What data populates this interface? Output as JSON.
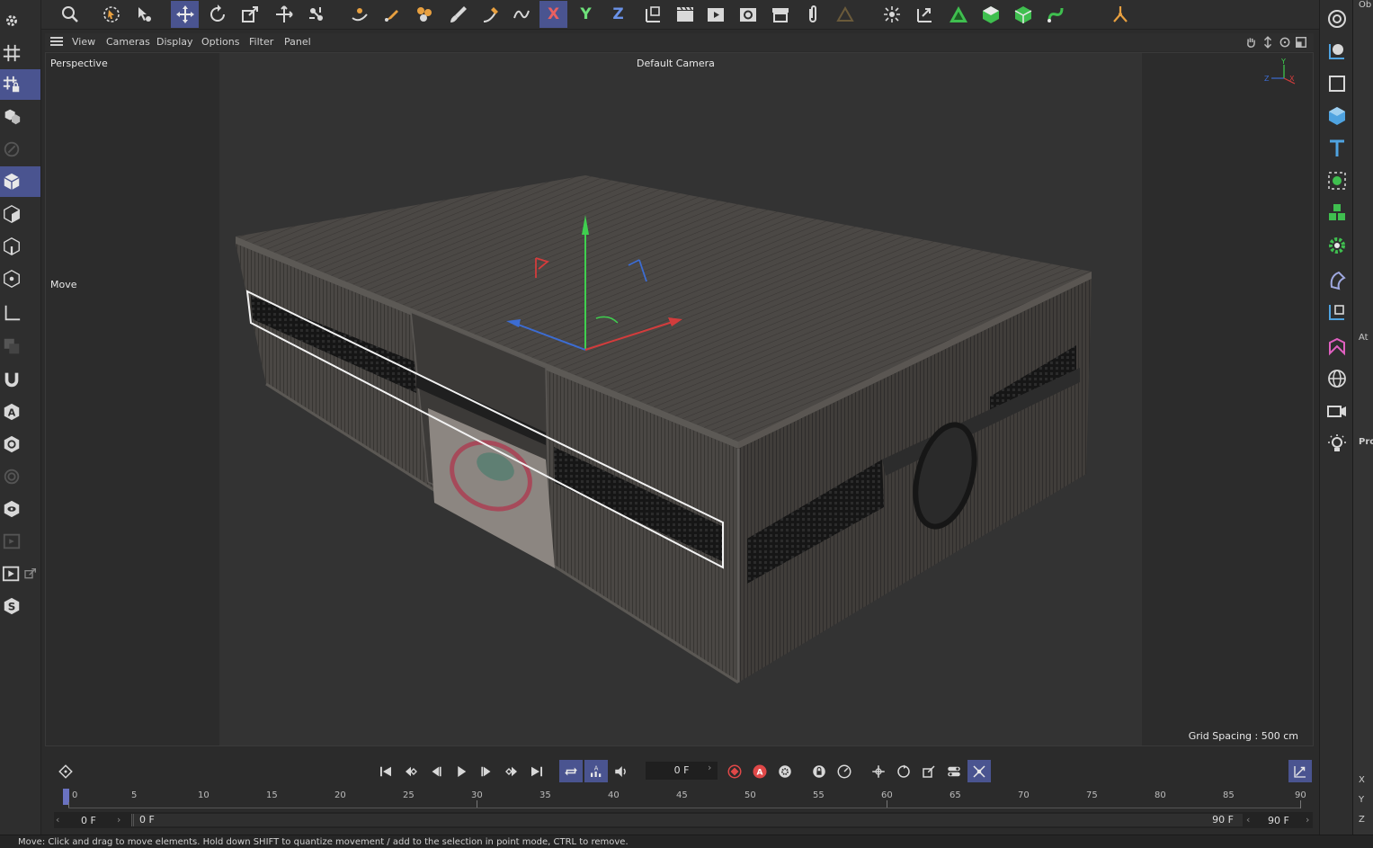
{
  "viewport": {
    "menu": [
      "View",
      "Cameras",
      "Display",
      "Options",
      "Filter",
      "Panel"
    ],
    "view_name": "Perspective",
    "camera": "Default Camera",
    "tool_label": "Move",
    "grid_spacing": "Grid Spacing : 500 cm",
    "axis_labels": {
      "x": "X",
      "y": "Y",
      "z": "Z"
    }
  },
  "toolbar": {
    "axis_x": "X",
    "axis_y": "Y",
    "axis_z": "Z",
    "active_tool": "move-tool"
  },
  "timeline": {
    "current_frame": "0 F",
    "ruler": [
      "0",
      "5",
      "10",
      "15",
      "20",
      "25",
      "30",
      "35",
      "40",
      "45",
      "50",
      "55",
      "60",
      "65",
      "70",
      "75",
      "80",
      "85",
      "90"
    ],
    "range_start": "0 F",
    "range_current": "0 F",
    "range_end": "90 F",
    "range_max": "90 F"
  },
  "side_panel": {
    "labels": [
      "Ob",
      "At",
      "Pro"
    ],
    "coords": [
      "X",
      "Y",
      "Z"
    ]
  },
  "status": "Move: Click and drag to move elements. Hold down SHIFT to quantize movement / add to the selection in point mode, CTRL to remove.",
  "colors": {
    "accent": "#4a5490",
    "x_axis": "#d23c3c",
    "y_axis": "#3fcf4f",
    "z_axis": "#3c6cd2",
    "object_green": "#3fbf4f"
  }
}
